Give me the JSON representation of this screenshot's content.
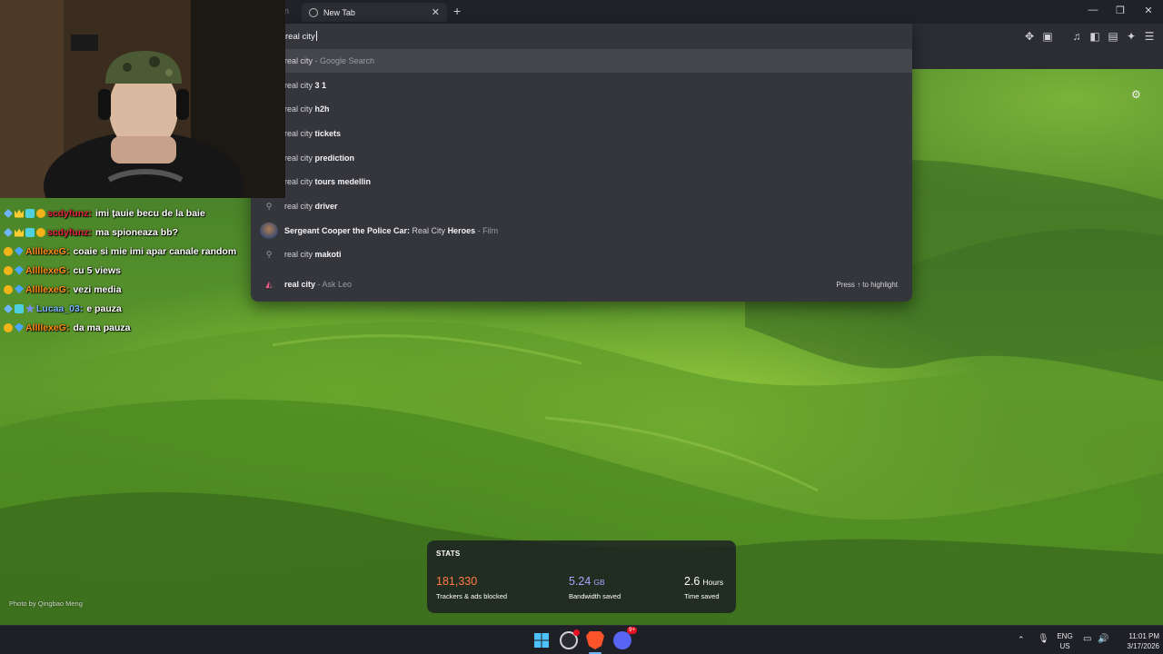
{
  "browser": {
    "tab_title": "New Tab",
    "prev_tab_fragment": "n",
    "new_tab_symbol": "+",
    "tab_close_symbol": "✕",
    "window_controls": [
      "—",
      "❐",
      "✕"
    ]
  },
  "omnibox": {
    "query": "real city",
    "suggestions": [
      {
        "icon": "",
        "prefix": "real city",
        "bold": "",
        "suffix": " - Google Search",
        "selected": true
      },
      {
        "icon": "",
        "prefix": "real city ",
        "bold": "3 1",
        "suffix": ""
      },
      {
        "icon": "",
        "prefix": "real city ",
        "bold": "h2h",
        "suffix": ""
      },
      {
        "icon": "",
        "prefix": "real city ",
        "bold": "tickets",
        "suffix": ""
      },
      {
        "icon": "",
        "prefix": "real city ",
        "bold": "prediction",
        "suffix": ""
      },
      {
        "icon": "",
        "prefix": "real city ",
        "bold": "tours medellin",
        "suffix": ""
      },
      {
        "icon": "search-icon",
        "prefix": "real city ",
        "bold": "driver",
        "suffix": ""
      },
      {
        "icon": "thumbnail",
        "bold_lead": "Sergeant Cooper the Police Car:",
        "mid": " Real City ",
        "bold_tail": "Heroes",
        "suffix": " - Film"
      },
      {
        "icon": "search-icon",
        "prefix": "real city ",
        "bold": "makoti",
        "suffix": ""
      }
    ],
    "leo": {
      "bold": "real city",
      "suffix": " - Ask Leo",
      "hint": "Press ↑ to highlight"
    }
  },
  "chat": [
    {
      "badges": [
        "sword",
        "crown",
        "grid",
        "coin"
      ],
      "user": "scdyfunz:",
      "user_color": "#e0263a",
      "message": "imi țauie becu de la baie"
    },
    {
      "badges": [
        "sword",
        "crown",
        "grid",
        "coin"
      ],
      "user": "scdyfunz:",
      "user_color": "#e0263a",
      "message": "ma spioneaza bb?"
    },
    {
      "badges": [
        "coin",
        "gem"
      ],
      "user": "AllllexeG:",
      "user_color": "#ff8c1a",
      "message": "coaie si mie imi apar canale random"
    },
    {
      "badges": [
        "coin",
        "gem"
      ],
      "user": "AllllexeG:",
      "user_color": "#ff8c1a",
      "message": "cu 5 views"
    },
    {
      "badges": [
        "coin",
        "gem"
      ],
      "user": "AllllexeG:",
      "user_color": "#ff8c1a",
      "message": "vezi media"
    },
    {
      "badges": [
        "sword",
        "grid",
        "star"
      ],
      "user": "Lucaa_03:",
      "user_color": "#7ab8ff",
      "message": "e pauza"
    },
    {
      "badges": [
        "coin",
        "gem"
      ],
      "user": "AllllexeG:",
      "user_color": "#ff8c1a",
      "message": "da ma pauza"
    }
  ],
  "stats": {
    "title": "STATS",
    "items": [
      {
        "value": "181,330",
        "unit": "",
        "label": "Trackers & ads blocked",
        "color": "#ff7b45"
      },
      {
        "value": "5.24",
        "unit": "GB",
        "label": "Bandwidth saved",
        "color": "#a8a6ff"
      },
      {
        "value": "2.6",
        "unit": "Hours",
        "label": "Time saved",
        "color": "#ffffff"
      }
    ]
  },
  "photo_credit": "Photo by Qingbao Meng",
  "taskbar": {
    "language": "ENG",
    "region": "US",
    "time": "11:01 PM",
    "date": "3/17/2026",
    "discord_badge": "9+"
  }
}
